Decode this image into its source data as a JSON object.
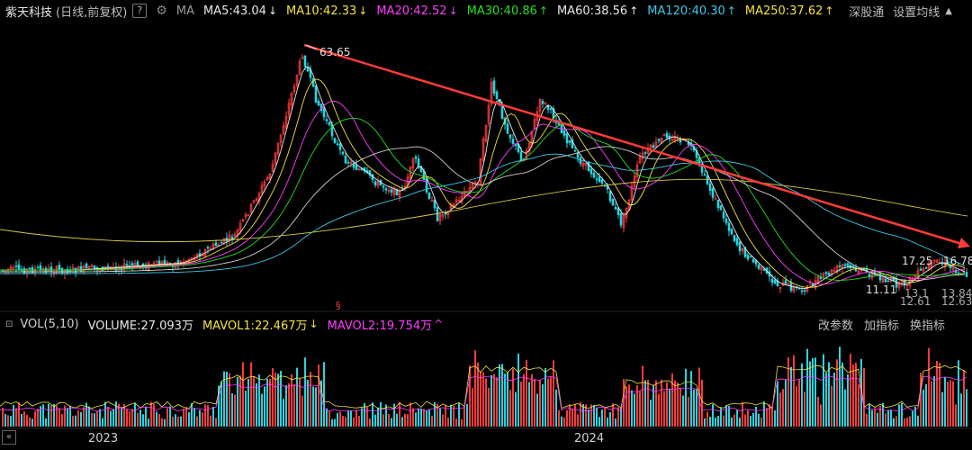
{
  "header": {
    "stock_name": "紫天科技",
    "mode": "(日线,前复权)",
    "help": "?",
    "ma_label": "MA",
    "ma_items": [
      {
        "text": "MA5:43.04",
        "arrow": "↓",
        "color": "#e8e8e8"
      },
      {
        "text": "MA10:42.33",
        "arrow": "↓",
        "color": "#f3e33b"
      },
      {
        "text": "MA20:42.52",
        "arrow": "↓",
        "color": "#ff3cff"
      },
      {
        "text": "MA30:40.86",
        "arrow": "↑",
        "color": "#22e022"
      },
      {
        "text": "MA60:38.56",
        "arrow": "↑",
        "color": "#e8e8e8"
      },
      {
        "text": "MA120:40.30",
        "arrow": "↑",
        "color": "#3cc8e8"
      },
      {
        "text": "MA250:37.62",
        "arrow": "↑",
        "color": "#f3e33b"
      }
    ],
    "right": {
      "shenzhen": "深股通",
      "settings": "设置均线",
      "caret": "▲"
    }
  },
  "chart": {
    "high_label": "63.65",
    "right_labels": {
      "a": "17.25",
      "b": "16.78",
      "c": "11.11",
      "d": "13.84",
      "e": "12.61",
      "f": "12.63",
      "g": "13.1"
    },
    "marker": "§",
    "colors": {
      "up": "#ff3b3b",
      "down": "#26d5e0",
      "trend": "#ff3b3b"
    }
  },
  "volume": {
    "label": "VOL(5,10)",
    "volume_text": "VOLUME:27.093万",
    "mavol1_text": "MAVOL1:22.467万",
    "mavol1_arrow": "↓",
    "mavol2_text": "MAVOL2:19.754万",
    "mavol2_arrow": "^",
    "right": {
      "change_params": "改参数",
      "add_indicator": "加指标",
      "switch_indicator": "换指标"
    }
  },
  "axis": {
    "years": [
      "2023",
      "2024"
    ]
  }
}
